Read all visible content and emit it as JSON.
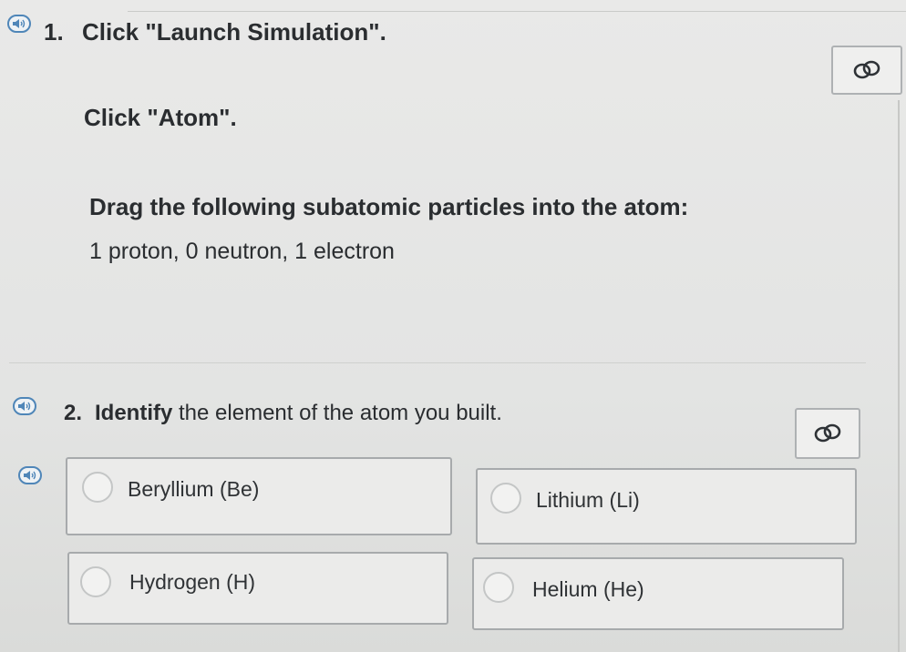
{
  "question1": {
    "number": "1.",
    "line1": "Click \"Launch Simulation\".",
    "line2": "Click \"Atom\".",
    "line3": "Drag the following subatomic particles into the atom:",
    "line4": "1 proton, 0 neutron, 1 electron"
  },
  "question2": {
    "number": "2.",
    "prompt_bold": "Identify",
    "prompt_rest": "the element of the atom you built.",
    "choices": [
      {
        "label": "Beryllium (Be)"
      },
      {
        "label": "Lithium (Li)"
      },
      {
        "label": "Hydrogen (H)"
      },
      {
        "label": "Helium (He)"
      }
    ]
  },
  "icons": {
    "audio": "speaker-icon",
    "link": "link-icon"
  },
  "colors": {
    "speaker_blue": "#4f86b8",
    "text": "#2a2d30"
  }
}
